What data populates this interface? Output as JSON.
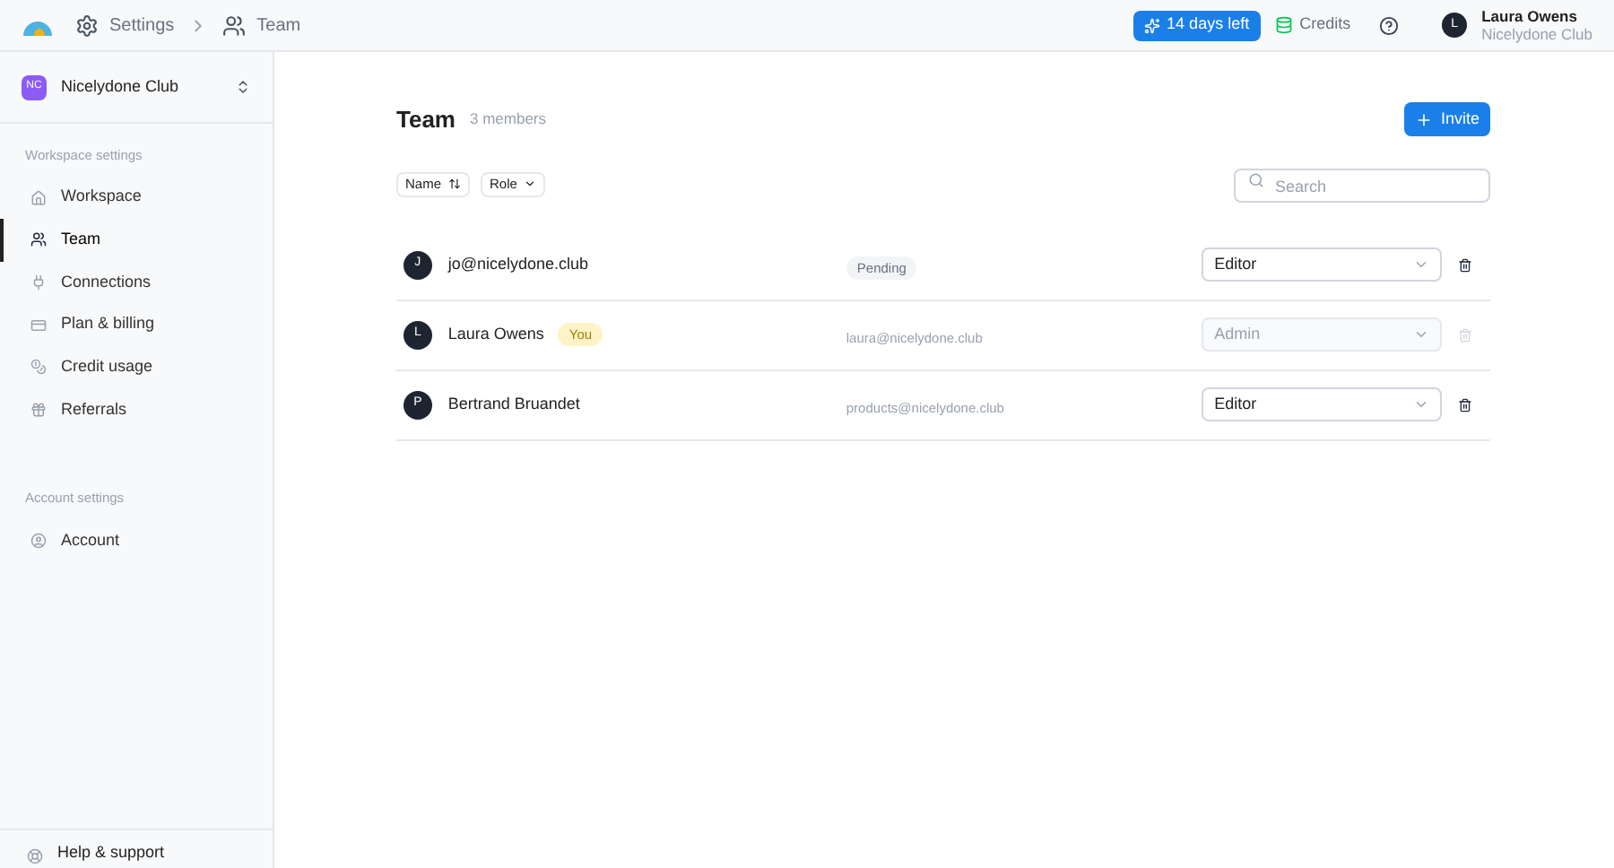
{
  "breadcrumb": {
    "items": [
      "Settings",
      "Team"
    ]
  },
  "header": {
    "trial": "14 days left",
    "credits": "Credits",
    "user": {
      "initial": "L",
      "name": "Laura Owens",
      "org": "Nicelydone Club"
    }
  },
  "sidebar": {
    "workspace": {
      "initials": "NC",
      "name": "Nicelydone Club"
    },
    "sections": [
      {
        "title": "Workspace settings",
        "items": [
          {
            "label": "Workspace",
            "kind": "home",
            "selected": false
          },
          {
            "label": "Team",
            "kind": "team",
            "selected": true
          },
          {
            "label": "Connections",
            "kind": "plug",
            "selected": false
          },
          {
            "label": "Plan & billing",
            "kind": "card",
            "selected": false
          },
          {
            "label": "Credit usage",
            "kind": "coins",
            "selected": false
          },
          {
            "label": "Referrals",
            "kind": "gift",
            "selected": false
          }
        ]
      },
      {
        "title": "Account settings",
        "items": [
          {
            "label": "Account",
            "kind": "user",
            "selected": false
          }
        ]
      }
    ],
    "footer": "Help & support"
  },
  "page": {
    "title": "Team",
    "count": "3 members",
    "invite": "Invite",
    "filters": [
      {
        "label": "Name",
        "kind": "sort"
      },
      {
        "label": "Role",
        "kind": "dropdown"
      }
    ],
    "search": {
      "placeholder": "Search"
    }
  },
  "members": [
    {
      "initial": "J",
      "name": "jo@nicelydone.club",
      "status": "Pending",
      "role": "Editor",
      "disabled": false
    },
    {
      "initial": "L",
      "name": "Laura Owens",
      "badge": "You",
      "email": "laura@nicelydone.club",
      "role": "Admin",
      "disabled": true
    },
    {
      "initial": "P",
      "name": "Bertrand Bruandet",
      "email": "products@nicelydone.club",
      "role": "Editor",
      "disabled": false
    }
  ]
}
